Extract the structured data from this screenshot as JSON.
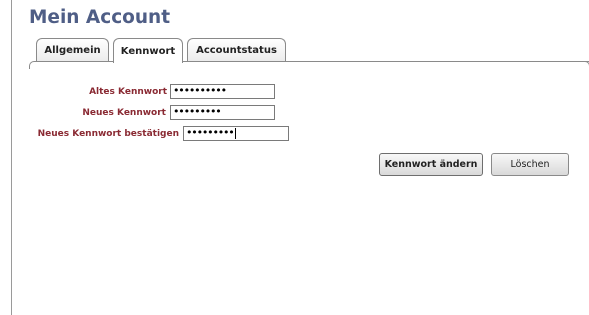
{
  "page": {
    "title": "Mein Account"
  },
  "tabs": [
    {
      "label": "Allgemein",
      "active": false
    },
    {
      "label": "Kennwort",
      "active": true
    },
    {
      "label": "Accountstatus",
      "active": false
    }
  ],
  "form": {
    "old_password": {
      "label": "Altes Kennwort",
      "value": "••••••••••"
    },
    "new_password": {
      "label": "Neues Kennwort",
      "value": "•••••••••"
    },
    "confirm_password": {
      "label": "Neues Kennwort bestätigen",
      "value": "•••••••••"
    }
  },
  "buttons": {
    "change_label": "Kennwort ändern",
    "delete_label": "Löschen"
  },
  "colors": {
    "title": "#4f5e86",
    "label": "#8a2a33",
    "border": "#8a8a8a"
  }
}
